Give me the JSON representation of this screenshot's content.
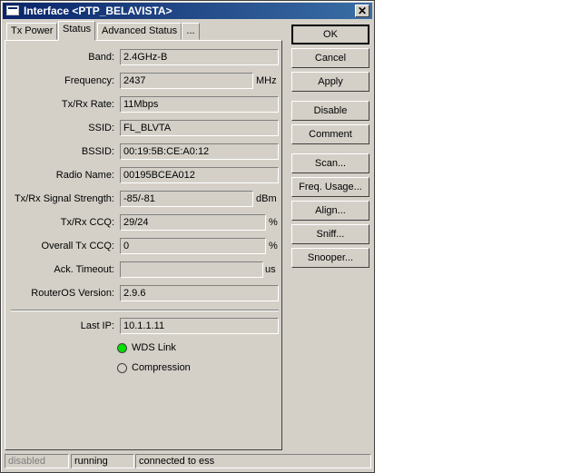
{
  "window": {
    "title": "Interface <PTP_BELAVISTA>"
  },
  "tabs": [
    {
      "label": "Tx Power"
    },
    {
      "label": "Status"
    },
    {
      "label": "Advanced Status"
    },
    {
      "label": "..."
    }
  ],
  "fields": {
    "band": {
      "label": "Band:",
      "value": "2.4GHz-B"
    },
    "frequency": {
      "label": "Frequency:",
      "value": "2437",
      "unit": "MHz"
    },
    "txrx_rate": {
      "label": "Tx/Rx Rate:",
      "value": "11Mbps"
    },
    "ssid": {
      "label": "SSID:",
      "value": "FL_BLVTA"
    },
    "bssid": {
      "label": "BSSID:",
      "value": "00:19:5B:CE:A0:12"
    },
    "radio_name": {
      "label": "Radio Name:",
      "value": "00195BCEA012"
    },
    "signal": {
      "label": "Tx/Rx Signal Strength:",
      "value": "-85/-81",
      "unit": "dBm"
    },
    "ccq": {
      "label": "Tx/Rx CCQ:",
      "value": "29/24",
      "unit": "%"
    },
    "overall_ccq": {
      "label": "Overall Tx CCQ:",
      "value": "0",
      "unit": "%"
    },
    "ack_timeout": {
      "label": "Ack. Timeout:",
      "value": "",
      "unit": "us"
    },
    "routeros": {
      "label": "RouterOS Version:",
      "value": "2.9.6"
    },
    "last_ip": {
      "label": "Last IP:",
      "value": "10.1.1.11"
    }
  },
  "indicators": {
    "wds_link": {
      "label": "WDS Link",
      "on": true,
      "color": "#00e000"
    },
    "compression": {
      "label": "Compression",
      "on": false,
      "color": "#d4d0c8"
    }
  },
  "buttons": {
    "ok": "OK",
    "cancel": "Cancel",
    "apply": "Apply",
    "disable": "Disable",
    "comment": "Comment",
    "scan": "Scan...",
    "freq_usage": "Freq. Usage...",
    "align": "Align...",
    "sniff": "Sniff...",
    "snooper": "Snooper..."
  },
  "status_bar": {
    "state": "disabled",
    "running": "running",
    "connection": "connected to ess"
  }
}
